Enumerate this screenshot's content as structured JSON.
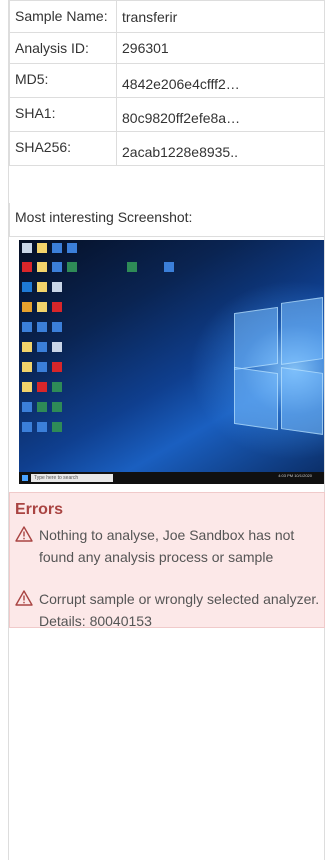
{
  "sample_info": {
    "rows": [
      {
        "key": "Sample Name:",
        "value": "transferir"
      },
      {
        "key": "Analysis ID:",
        "value": "296301"
      },
      {
        "key": "MD5:",
        "value": "4842e206e4cfff2…"
      },
      {
        "key": "SHA1:",
        "value": "80c9820ff2efe8a…"
      },
      {
        "key": "SHA256:",
        "value": "2acab1228e8935.."
      }
    ]
  },
  "screenshot": {
    "label": "Most interesting Screenshot:",
    "taskbar_search": "Type here to search",
    "taskbar_time": "4:03 PM 10/1/2020"
  },
  "errors": {
    "title": "Errors",
    "items": [
      "Nothing to analyse, Joe Sandbox has not found any analysis process or sample",
      "Corrupt sample or wrongly selected analyzer. Details: 80040153"
    ]
  },
  "colors": {
    "error_title": "#a94442",
    "error_bg": "#fce8e8",
    "warning_icon": "#a94442"
  }
}
